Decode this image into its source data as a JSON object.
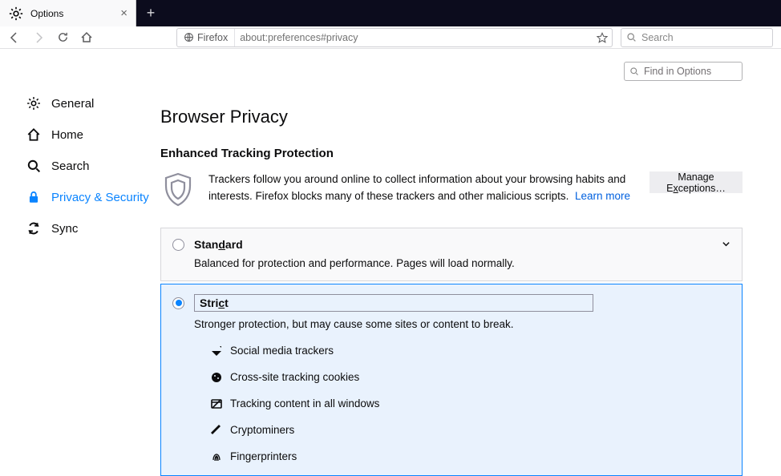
{
  "tab_title": "Options",
  "url_identity": "Firefox",
  "url": "about:preferences#privacy",
  "search_placeholder": "Search",
  "find_placeholder": "Find in Options",
  "sidebar": {
    "items": [
      {
        "label": "General"
      },
      {
        "label": "Home"
      },
      {
        "label": "Search"
      },
      {
        "label": "Privacy & Security"
      },
      {
        "label": "Sync"
      }
    ]
  },
  "page_title": "Browser Privacy",
  "etp": {
    "heading": "Enhanced Tracking Protection",
    "body": "Trackers follow you around online to collect information about your browsing habits and interests. Firefox blocks many of these trackers and other malicious scripts.",
    "learn_more": "Learn more",
    "exceptions": "Manage Exceptions…"
  },
  "standard": {
    "label": "Standard",
    "desc": "Balanced for protection and performance. Pages will load normally."
  },
  "strict": {
    "label": "Strict",
    "desc": "Stronger protection, but may cause some sites or content to break.",
    "items": [
      "Social media trackers",
      "Cross-site tracking cookies",
      "Tracking content in all windows",
      "Cryptominers",
      "Fingerprinters"
    ]
  }
}
